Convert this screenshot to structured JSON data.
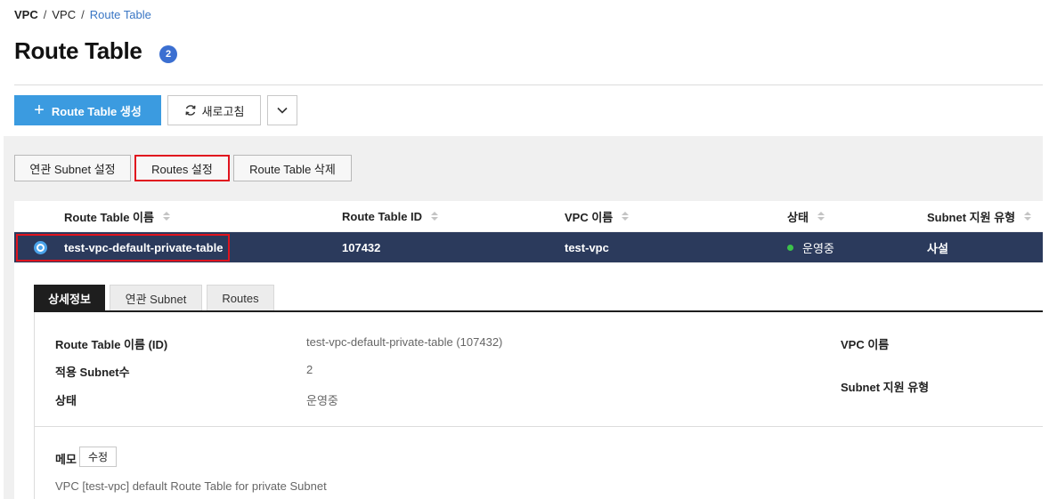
{
  "breadcrumb": {
    "root": "VPC",
    "sep1": "/",
    "mid": "VPC",
    "sep2": "/",
    "current": "Route Table"
  },
  "page": {
    "title": "Route Table",
    "badge_count": "2"
  },
  "toolbar": {
    "create_label": "Route Table 생성",
    "create_icon": "plus-icon",
    "refresh_label": "새로고침",
    "refresh_icon": "refresh-icon",
    "more_icon": "chevron-down-icon"
  },
  "actions": {
    "subnet_assoc": "연관 Subnet 설정",
    "routes": "Routes 설정",
    "delete": "Route Table 삭제"
  },
  "table": {
    "columns": [
      "Route Table 이름",
      "Route Table ID",
      "VPC 이름",
      "상태",
      "Subnet 지원 유형"
    ],
    "rows": [
      {
        "name": "test-vpc-default-private-table",
        "id": "107432",
        "vpc": "test-vpc",
        "status": "운영중",
        "subnet_type": "사설",
        "selected": true
      }
    ]
  },
  "detail": {
    "tabs": [
      "상세정보",
      "연관 Subnet",
      "Routes"
    ],
    "active_tab": "상세정보",
    "fields": {
      "name_label": "Route Table 이름 (ID)",
      "name_value": "test-vpc-default-private-table (107432)",
      "subnet_count_label": "적용 Subnet수",
      "subnet_count_value": "2",
      "status_label": "상태",
      "status_value": "운영중",
      "vpc_label": "VPC 이름",
      "subnet_type_label": "Subnet 지원 유형"
    },
    "memo": {
      "label": "메모",
      "edit_label": "수정",
      "text": "VPC [test-vpc] default Route Table for private Subnet"
    }
  },
  "colors": {
    "primary": "#3b9be0",
    "selected_row": "#2b3a5c",
    "highlight_border": "#e0141e",
    "status_running": "#3cc24a",
    "badge": "#3b6fd1"
  }
}
